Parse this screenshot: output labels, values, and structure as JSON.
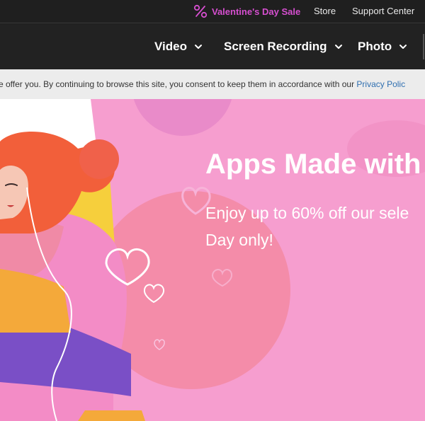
{
  "topbar": {
    "sale_label": "Valentine's Day Sale",
    "sale_icon": "percent-icon",
    "store_label": "Store",
    "support_label": "Support Center",
    "sale_color": "#d64fd0"
  },
  "nav": {
    "items": [
      {
        "label": "Video"
      },
      {
        "label": "Screen Recording"
      },
      {
        "label": "Photo"
      }
    ]
  },
  "cookie": {
    "text": "e offer you. By continuing to browse this site, you consent to keep them in accordance with our ",
    "link": "Privacy Polic"
  },
  "hero": {
    "headline": "Apps Made with",
    "subline_1": "Enjoy up to 60% off our sele",
    "subline_2": "Day only!",
    "background": "#f69ecf"
  }
}
